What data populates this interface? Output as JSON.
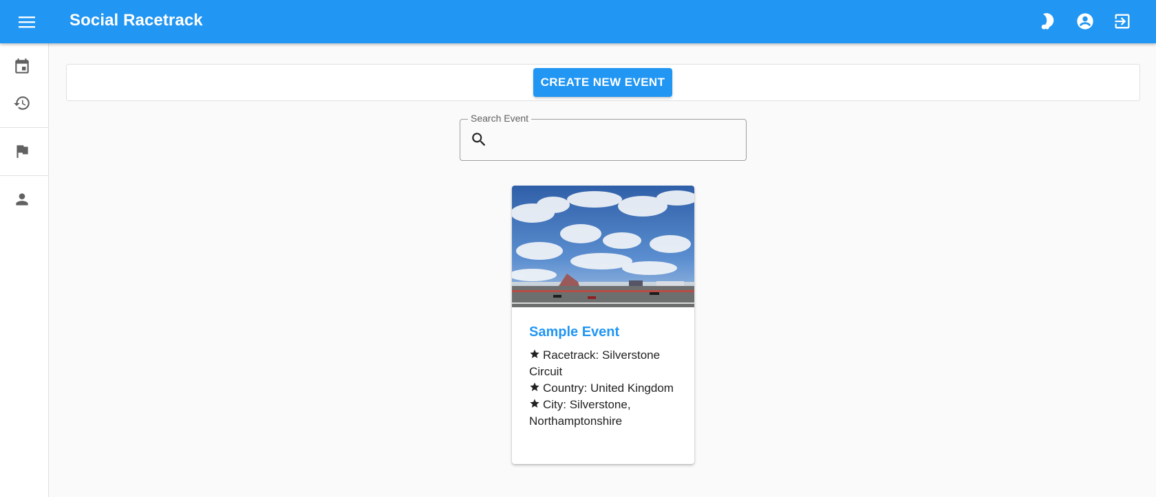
{
  "app": {
    "title": "Social Racetrack"
  },
  "header": {
    "actions": [
      {
        "icon": "theme-toggle-icon"
      },
      {
        "icon": "account-circle-icon"
      },
      {
        "icon": "logout-icon"
      }
    ]
  },
  "nav": {
    "items": [
      {
        "icon": "calendar-icon"
      },
      {
        "icon": "history-icon"
      },
      {
        "icon": "flag-icon"
      },
      {
        "icon": "person-icon"
      }
    ]
  },
  "toolbar": {
    "create_label": "CREATE NEW EVENT"
  },
  "search": {
    "label": "Search Event",
    "value": ""
  },
  "events": [
    {
      "title": "Sample Event",
      "racetrack": "Racetrack: Silverstone Circuit",
      "country": "Country: United Kingdom",
      "city": "City: Silverstone, Northamptonshire"
    }
  ],
  "colors": {
    "primary": "#2196f3",
    "background": "#fafafa"
  }
}
